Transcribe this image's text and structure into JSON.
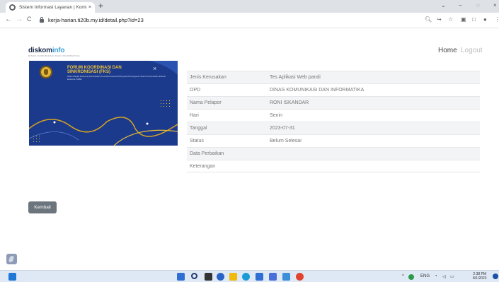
{
  "browser": {
    "tab_title": "Sistem Informasi Layanan | Komi",
    "tab_close": "×",
    "new_tab": "+",
    "url": "kerja-harian.ti20b.my.id/detail.php?id=23",
    "nav": {
      "back": "←",
      "forward": "→",
      "reload": "C"
    },
    "window": {
      "chevron": "⌄",
      "minimize": "–",
      "restore": "◌",
      "close": "×"
    },
    "toolbar_icons": [
      "search-icon",
      "share-icon",
      "star-icon",
      "extensions-icon",
      "sidepanel-icon",
      "profile-icon",
      "menu-icon"
    ]
  },
  "header": {
    "logo_part1": "diskom",
    "logo_part2": "info",
    "logo_subtitle": "DINAS KOMUNIKASI DAN INFORMATIKA",
    "nav": {
      "home": "Home",
      "logout": "Logout"
    }
  },
  "banner": {
    "title": "FORUM KOORDINASI DAN SINKRONISASI (FKS)",
    "subtitle": "Dalam Rangka Monitoring Pemanfaatan Pusat Data Nasional (PDN) pada Pembangunan Sistem Pemerintahan Berbasis Elektronik (SPBE)",
    "close": "×"
  },
  "detail": {
    "rows": [
      {
        "label": "Jenis Kerusakan",
        "value": "Tes Aplikasi Web pandi"
      },
      {
        "label": "OPD",
        "value": "DINAS KOMUNIKASI DAN INFORMATIKA"
      },
      {
        "label": "Nama Pelapor",
        "value": "RONI ISKANDAR"
      },
      {
        "label": "Hari",
        "value": "Senin"
      },
      {
        "label": "Tanggal",
        "value": "2023-07-31"
      },
      {
        "label": "Status",
        "value": "Belum Selesai"
      },
      {
        "label": "Data Perbaikan",
        "value": ""
      },
      {
        "label": "Keterangan",
        "value": ""
      }
    ]
  },
  "actions": {
    "back_label": "Kembali"
  },
  "taskbar": {
    "lang": "ENG",
    "time": "2:38 PM",
    "date": "8/1/2023",
    "colors": {
      "start": "#2f6fd1",
      "search": "#1f3b6e",
      "files": "#f0b90b",
      "edge": "#1a9bd7",
      "store": "#2f6fd1",
      "chrome": "#e0442f"
    }
  }
}
